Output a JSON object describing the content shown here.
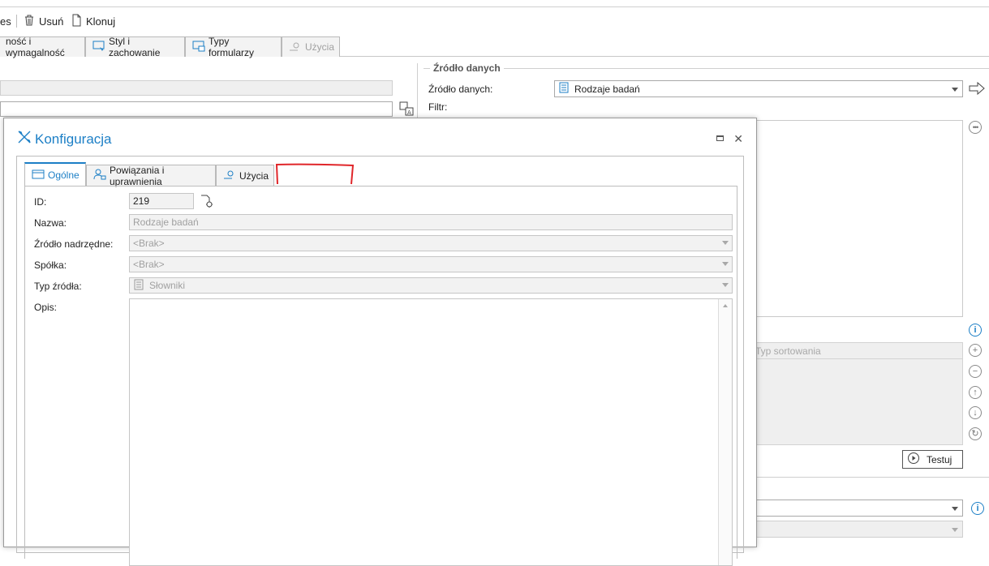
{
  "toolbar": {
    "partial_left": "es",
    "delete_label": "Usuń",
    "clone_label": "Klonuj"
  },
  "main_tabs": [
    {
      "label": "ność i wymagalność"
    },
    {
      "label": "Styl i zachowanie"
    },
    {
      "label": "Typy formularzy"
    },
    {
      "label": "Użycia"
    }
  ],
  "datasource": {
    "group_title": "Źródło danych",
    "source_label": "Źródło danych:",
    "source_value": "Rodzaje badań",
    "filter_label": "Filtr:",
    "sort_type_placeholder": "Typ sortowania",
    "test_button": "Testuj"
  },
  "dialog": {
    "title": "Konfiguracja",
    "tabs": [
      {
        "label": "Ogólne"
      },
      {
        "label": "Powiązania i uprawnienia"
      },
      {
        "label": "Użycia"
      }
    ],
    "fields": {
      "id_label": "ID:",
      "id_value": "219",
      "name_label": "Nazwa:",
      "name_value": "Rodzaje badań",
      "parent_label": "Źródło nadrzędne:",
      "parent_value": "<Brak>",
      "company_label": "Spółka:",
      "company_value": "<Brak>",
      "type_label": "Typ źródła:",
      "type_value": "Słowniki",
      "desc_label": "Opis:"
    }
  },
  "colors": {
    "accent": "#1c7fc6",
    "annotation": "#e0262a"
  },
  "icons": {
    "delete": "trash-icon",
    "clone": "document-icon",
    "tools": "tools-icon",
    "datasource": "list-document-icon",
    "arrow": "arrow-right-icon",
    "more": "ellipsis-circle-icon",
    "info": "info-circle-icon"
  }
}
